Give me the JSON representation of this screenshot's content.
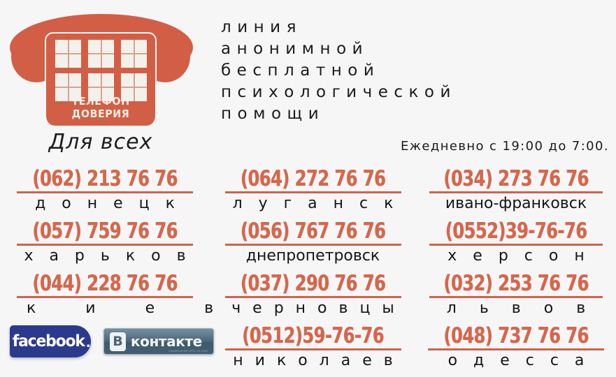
{
  "poster": {
    "background_color": "#f6f6f6",
    "accent_color": "#d5674c",
    "text_color": "#1b1b1b"
  },
  "logo": {
    "caption": "ТЕЛЕФОН ДОВЕРИЯ",
    "subtitle": "Для всех",
    "icon_name": "phone-house-logo",
    "color": "#d25f45"
  },
  "headline": {
    "line1": "линия",
    "line2": "анонимной",
    "line3": "бесплатной",
    "line4": "психологической",
    "line5": "помощи"
  },
  "schedule": "Ежедневно с 19:00 до 7:00.",
  "cities": [
    {
      "phone": "(062) 213 76 76",
      "city": "д о н е ц к",
      "spacing": "sp-mid"
    },
    {
      "phone": "(064) 272 76 76",
      "city": "л у г а н с к",
      "spacing": "sp-mid"
    },
    {
      "phone": "(034) 273 76 76",
      "city": "ивано-франковск",
      "spacing": "sp-none"
    },
    {
      "phone": "(057) 759 76 76",
      "city": "х а р ь к о в",
      "spacing": "sp-mid"
    },
    {
      "phone": "(056) 767 76 76",
      "city": "днепропетровск",
      "spacing": "sp-none"
    },
    {
      "phone": "(0552)39-76-76",
      "city": "х е р с о н",
      "spacing": "sp-mid"
    },
    {
      "phone": "(044) 228 76 76",
      "city": "к и е в",
      "spacing": "sp-xwide"
    },
    {
      "phone": "(037) 290 76 76",
      "city": "ч е р н о в ц ы",
      "spacing": "sp-small"
    },
    {
      "phone": "(032) 253 76 76",
      "city": "л ь в о в",
      "spacing": "sp-wide"
    },
    {
      "phone": "(0512)59-76-76",
      "city": "н и к о л а е в",
      "spacing": "sp-small"
    },
    {
      "phone": "(048) 737 76 76",
      "city": "о д е с с а",
      "spacing": "sp-mid"
    }
  ],
  "social": {
    "facebook": {
      "label": "facebook",
      "dot": ".",
      "color": "#2b3a8c"
    },
    "vkontakte": {
      "icon_letter": "В",
      "label": "контакте",
      "sub": "социальная сеть vk.com",
      "color": "#4a6477"
    }
  }
}
